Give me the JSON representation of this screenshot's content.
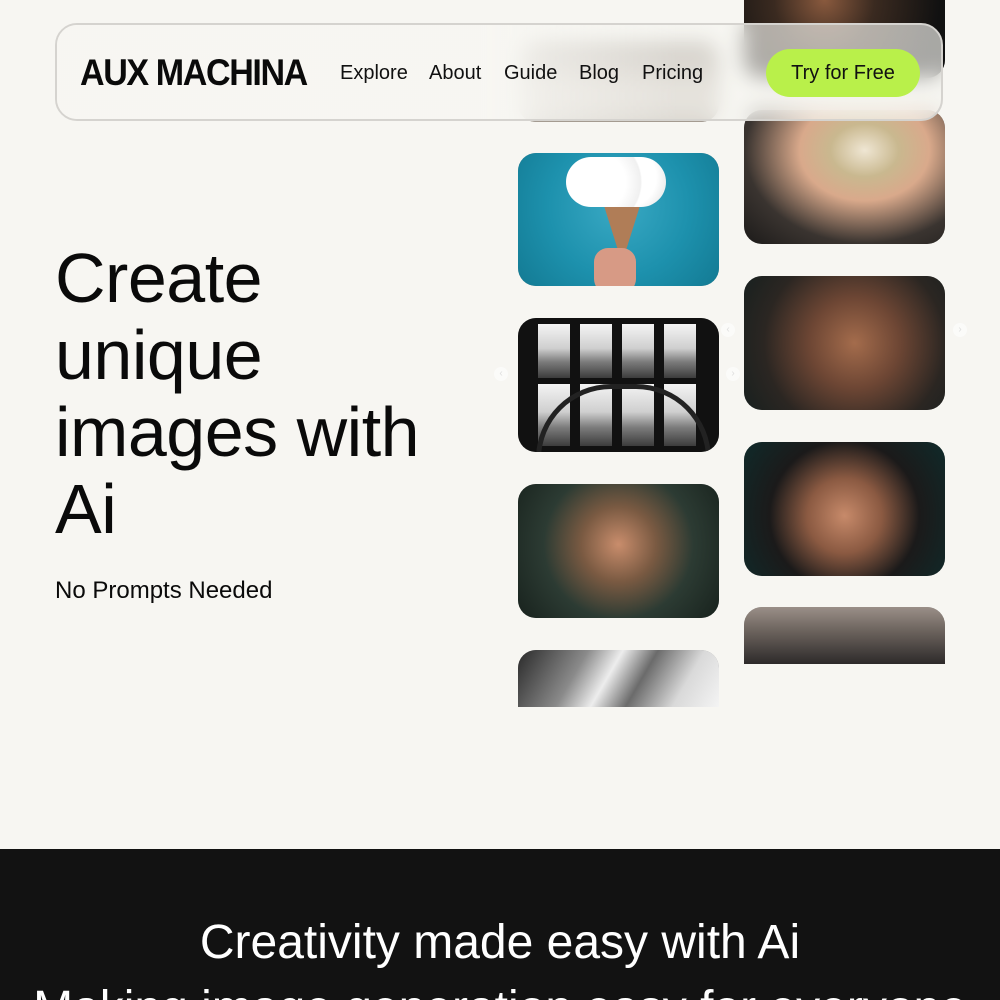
{
  "header": {
    "logo": "AUX MACHINA",
    "nav": [
      "Explore",
      "About",
      "Guide",
      "Blog",
      "Pricing"
    ],
    "cta": "Try for Free"
  },
  "hero": {
    "title": "Create unique images with Ai",
    "subtitle": "No Prompts Needed"
  },
  "gallery": {
    "arrow_glyph": "›",
    "arrow_glyph_left": "‹"
  },
  "section2": {
    "title": "Creativity made easy with Ai",
    "subtitle": "Making image generation easy for everyone"
  },
  "colors": {
    "background": "#f7f6f2",
    "cta": "#b9f04a",
    "dark_section": "#121212"
  }
}
